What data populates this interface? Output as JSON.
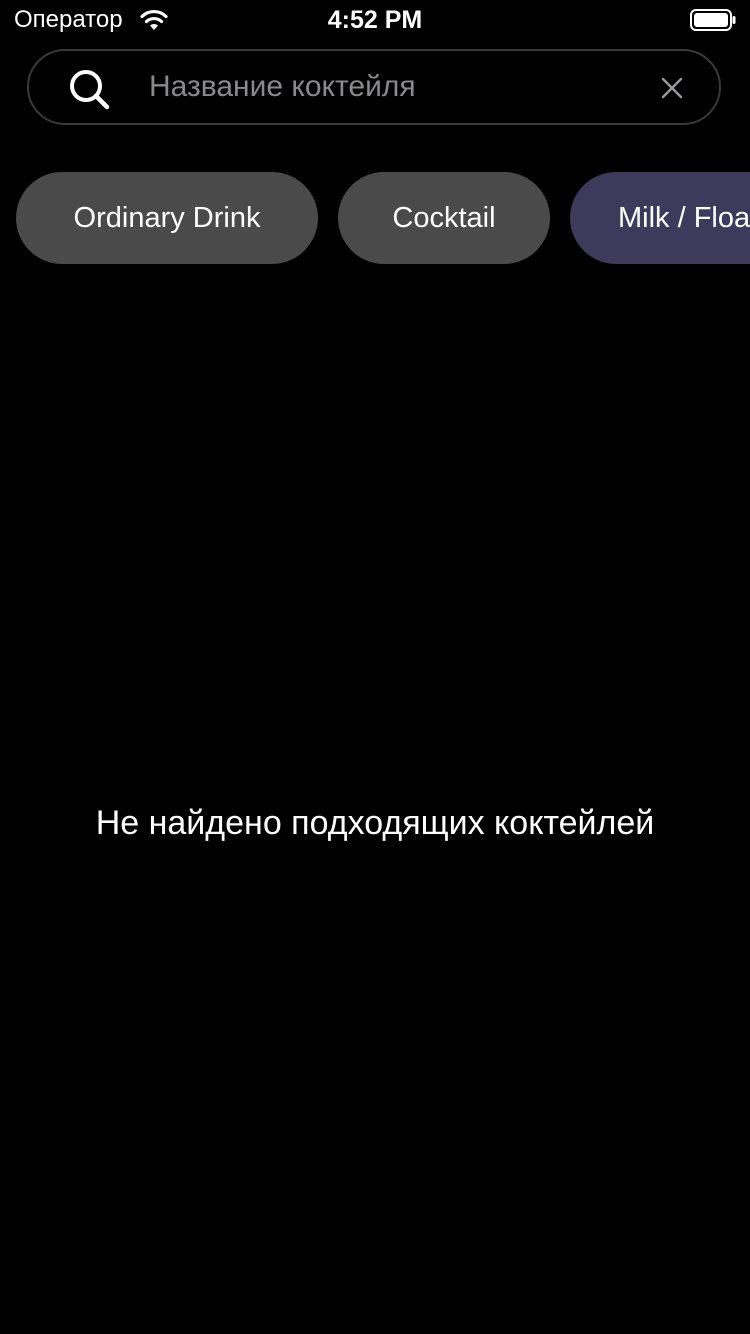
{
  "status_bar": {
    "carrier": "Оператор",
    "time": "4:52 PM",
    "wifi_icon": "wifi-icon",
    "battery_icon": "battery-icon"
  },
  "search": {
    "placeholder": "Название коктейля",
    "value": "",
    "search_icon": "search-icon",
    "clear_icon": "close-icon"
  },
  "categories": [
    {
      "label": "Ordinary Drink",
      "selected": false
    },
    {
      "label": "Cocktail",
      "selected": false
    },
    {
      "label": "Milk / Float / Shake",
      "selected": true
    }
  ],
  "empty_state": {
    "message": "Не найдено подходящих коктейлей"
  },
  "colors": {
    "background": "#000000",
    "chip": "#4a4a4a",
    "chip_selected": "#3d3a5c",
    "search_border": "#3a3a3c",
    "placeholder": "#8a8a8e",
    "text": "#ffffff"
  }
}
